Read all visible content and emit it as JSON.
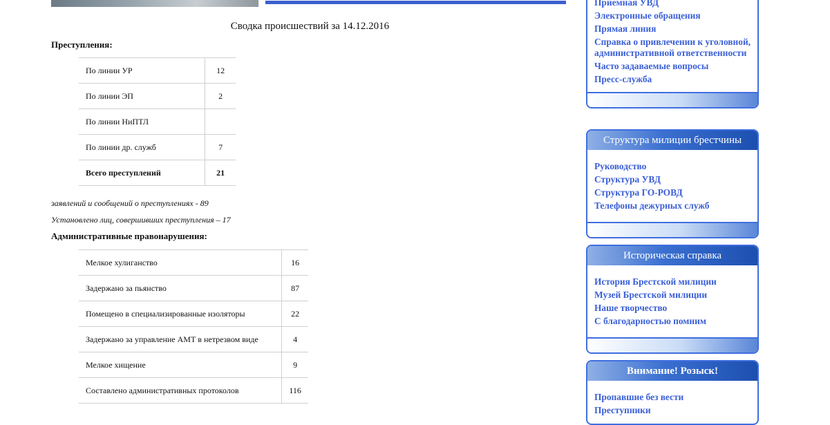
{
  "summary": {
    "title": "Сводка происшествий за 14.12.2016",
    "crimes_heading": "Преступления:",
    "crimes": [
      {
        "label": "По линии УР",
        "value": "12"
      },
      {
        "label": "По линии ЭП",
        "value": "2"
      },
      {
        "label": "По линии НиПТЛ",
        "value": ""
      },
      {
        "label": "По линии др. служб",
        "value": "7"
      },
      {
        "label": "Всего преступлений",
        "value": "21"
      }
    ],
    "line_reports": "заявлений и сообщений о преступлениях - 89",
    "line_persons": "Установлено лиц, совершивших преступления – 17",
    "admin_heading": "Административные правонарушения:",
    "admin": [
      {
        "label": "Мелкое хулиганство",
        "value": "16"
      },
      {
        "label": "Задержано за пьянство",
        "value": "87"
      },
      {
        "label": "Помещено в специализированные изоляторы",
        "value": "22"
      },
      {
        "label": "Задержано за управление АМТ в нетрезвом виде",
        "value": "4"
      },
      {
        "label": "Мелкое хищение",
        "value": "9"
      },
      {
        "label": "Составлено административных протоколов",
        "value": "116"
      }
    ]
  },
  "sidebar": {
    "block1": {
      "links": [
        "Приемная УВД",
        "Электронные обращения",
        "Прямая линия",
        "Справка о привлечении к уголовной, административной ответственности",
        "Часто задаваемые вопросы",
        "Пресс-служба"
      ]
    },
    "block2": {
      "title": "Структура милиции брестчины",
      "links": [
        "Руководство",
        "Структура УВД",
        "Структура ГО-РОВД",
        "Телефоны дежурных служб"
      ]
    },
    "block3": {
      "title": "Историческая справка",
      "links": [
        "История Брестской милиции",
        "Музей Брестской милиции",
        "Наше творчество",
        "С благодарностью помним"
      ]
    },
    "block4": {
      "title": "Внимание! Розыск!",
      "links": [
        "Пропавшие без вести",
        "Преступники"
      ]
    }
  },
  "colors": {
    "link": "#3a5fd6",
    "accent": "#3f6ee0",
    "header_dark": "#1c4fb0"
  }
}
